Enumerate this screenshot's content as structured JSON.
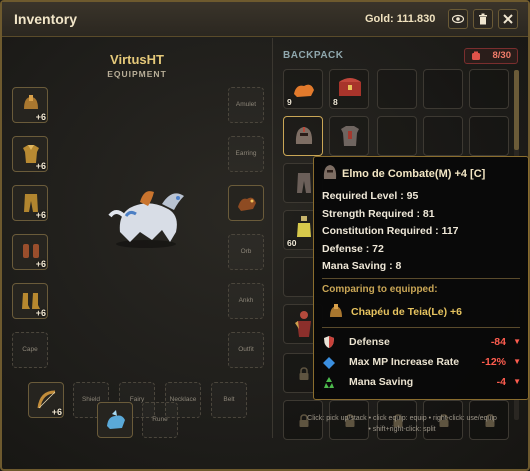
{
  "window": {
    "title": "Inventory",
    "gold": "Gold: 111.830"
  },
  "titlebar_buttons": [
    "eye-icon",
    "trash-icon",
    "close-icon"
  ],
  "character": {
    "name": "VirtusHT",
    "section": "EQUIPMENT"
  },
  "equipment": {
    "amulet": "Amulet",
    "earring": "Earring",
    "orb": "Orb",
    "ankh": "Ankh",
    "outfit": "Outfit",
    "cape": "Cape",
    "shield": "Shield",
    "fairy": "Fairy",
    "necklace": "Necklace",
    "belt": "Belt",
    "rune": "Rune",
    "helm_plus": "+6",
    "armor_plus": "+6",
    "pants_plus": "+6",
    "gloves_plus": "+6",
    "boots_plus": "+6",
    "weapon_plus": "+6"
  },
  "backpack": {
    "title": "BACKPACK",
    "count": "8/30",
    "items": [
      {
        "qty": "9",
        "icon": "orange-pet-icon"
      },
      {
        "qty": "8",
        "icon": "treasure-chest-icon"
      },
      {
        "qty": "",
        "icon": "helmet-icon"
      },
      {
        "qty": "",
        "icon": "armor-icon"
      },
      {
        "qty": "60",
        "icon": "potion-icon"
      }
    ]
  },
  "tooltip": {
    "item_name": "Elmo de Combate(M) +4 [C]",
    "lines": [
      "Required Level : 95",
      "Strength Required : 81",
      "Constitution Required : 117",
      "Defense : 72",
      "Mana Saving : 8"
    ],
    "compare_header": "Comparing to equipped:",
    "equipped_name": "Chapéu de Teia(Le) +6",
    "comparisons": [
      {
        "stat": "Defense",
        "value": "-84",
        "icon": "shield-icon"
      },
      {
        "stat": "Max MP Increase Rate",
        "value": "-12%",
        "icon": "blue-diamond-icon"
      },
      {
        "stat": "Mana Saving",
        "value": "-4",
        "icon": "recycle-icon"
      }
    ],
    "colors": {
      "negative": "#ff5d4f",
      "gold": "#e7c460"
    }
  },
  "help": {
    "line1": "Click: pick up/stack • click equip: equip • right-click: use/equip",
    "line2": "• shift+right-click: split"
  }
}
